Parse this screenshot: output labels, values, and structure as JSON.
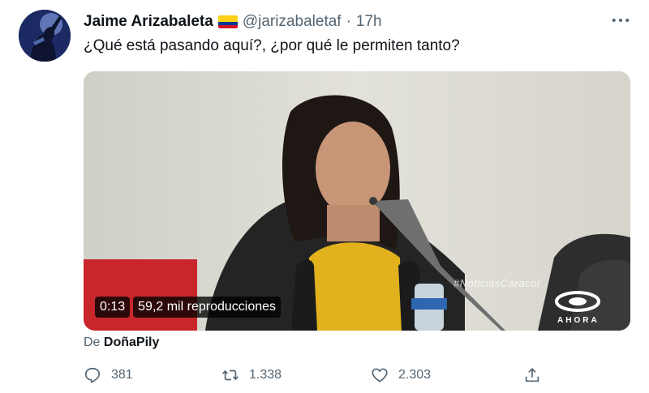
{
  "tweet": {
    "display_name": "Jaime Arizabaleta",
    "handle": "@jarizabaletaf",
    "separator": "·",
    "time": "17h",
    "text": "¿Qué está pasando aquí?, ¿por qué le permiten tanto?",
    "flag": "colombia-flag",
    "verified": false
  },
  "media": {
    "duration": "0:13",
    "views": "59,2 mil reproducciones",
    "watermark": "#NoticiasCaracol",
    "logo_word": "AHORA"
  },
  "attribution": {
    "prefix": "De",
    "source": "DoñaPily"
  },
  "actions": {
    "reply_count": "381",
    "retweet_count": "1.338",
    "like_count": "2.303",
    "icons": [
      "reply-icon",
      "retweet-icon",
      "like-icon",
      "share-icon"
    ]
  },
  "colors": {
    "text_primary": "#0f1419",
    "text_secondary": "#536471"
  }
}
